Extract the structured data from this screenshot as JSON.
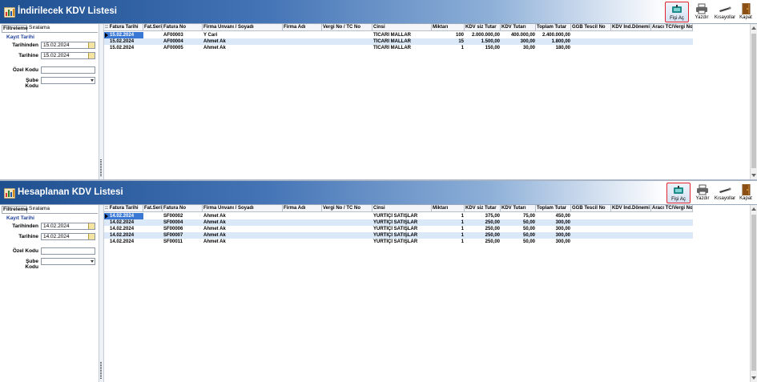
{
  "columns": [
    {
      "label": ":: Fatura Tarihi",
      "w": 49
    },
    {
      "label": "Fat.Seri",
      "w": 24
    },
    {
      "label": "Fatura No",
      "w": 50
    },
    {
      "label": "Firma Unvanı / Soyadı",
      "w": 100
    },
    {
      "label": "Firma Adı",
      "w": 49
    },
    {
      "label": "Vergi No / TC No",
      "w": 63
    },
    {
      "label": "Cinsi",
      "w": 74
    },
    {
      "label": "Miktarı",
      "w": 41
    },
    {
      "label": "KDV siz Tutar",
      "w": 45
    },
    {
      "label": "KDV Tutarı",
      "w": 44
    },
    {
      "label": "Toplam Tutar",
      "w": 44
    },
    {
      "label": "GGB Tescil No",
      "w": 50
    },
    {
      "label": "KDV İnd.Dönemi",
      "w": 50
    },
    {
      "label": "Aracı TC/Vergi No",
      "w": 52
    }
  ],
  "top": {
    "title": "İndirilecek KDV Listesi",
    "tabs": [
      "Filtreleme",
      "Sıralama"
    ],
    "filters": {
      "kayit_tarihi": "Kayıt Tarihi",
      "tarihinden_label": "Tarihinden",
      "tarihinden_value": "15.02.2024",
      "tarihine_label": "Tarihine",
      "tarihine_value": "15.02.2024",
      "ozel_kodu_label": "Özel Kodu",
      "ozel_kodu_value": "",
      "sube_kodu_label": "Şube Kodu",
      "sube_kodu_value": ""
    },
    "toolbar": {
      "fisi_ac": "Fişi Aç",
      "yazdir": "Yazdır",
      "kisayollar": "Kısayollar",
      "kapat": "Kapat"
    },
    "rows": [
      [
        "15.02.2024",
        "",
        "AF00003",
        "Y Cari",
        "",
        "",
        "TİCARİ MALLAR",
        "100",
        "2.000.000,00",
        "400.000,00",
        "2.400.000,00",
        "",
        "",
        ""
      ],
      [
        "15.02.2024",
        "",
        "AF00004",
        "Ahmet Ak",
        "",
        "",
        "TİCARİ MALLAR",
        "15",
        "1.500,00",
        "300,00",
        "1.800,00",
        "",
        "",
        ""
      ],
      [
        "15.02.2024",
        "",
        "AF00005",
        "Ahmet Ak",
        "",
        "",
        "TİCARİ MALLAR",
        "1",
        "150,00",
        "30,00",
        "180,00",
        "",
        "",
        ""
      ]
    ]
  },
  "bottom": {
    "title": "Hesaplanan KDV Listesi",
    "tabs": [
      "Filtreleme",
      "Sıralama"
    ],
    "filters": {
      "kayit_tarihi": "Kayıt Tarihi",
      "tarihinden_label": "Tarihinden",
      "tarihinden_value": "14.02.2024",
      "tarihine_label": "Tarihine",
      "tarihine_value": "14.02.2024",
      "ozel_kodu_label": "Özel Kodu",
      "ozel_kodu_value": "",
      "sube_kodu_label": "Şube Kodu",
      "sube_kodu_value": ""
    },
    "toolbar": {
      "fisi_ac": "Fişi Aç",
      "yazdir": "Yazdır",
      "kisayollar": "Kısayollar",
      "kapat": "Kapat"
    },
    "rows": [
      [
        "14.02.2024",
        "",
        "SF00002",
        "Ahmet Ak",
        "",
        "",
        "YURTİÇİ SATIŞLAR",
        "1",
        "375,00",
        "75,00",
        "450,00",
        "",
        "",
        ""
      ],
      [
        "14.02.2024",
        "",
        "SF00004",
        "Ahmet Ak",
        "",
        "",
        "YURTİÇİ SATIŞLAR",
        "1",
        "250,00",
        "50,00",
        "300,00",
        "",
        "",
        ""
      ],
      [
        "14.02.2024",
        "",
        "SF00006",
        "Ahmet Ak",
        "",
        "",
        "YURTİÇİ SATIŞLAR",
        "1",
        "250,00",
        "50,00",
        "300,00",
        "",
        "",
        ""
      ],
      [
        "14.02.2024",
        "",
        "SF00007",
        "Ahmet Ak",
        "",
        "",
        "YURTİÇİ SATIŞLAR",
        "1",
        "250,00",
        "50,00",
        "300,00",
        "",
        "",
        ""
      ],
      [
        "14.02.2024",
        "",
        "SF00011",
        "Ahmet Ak",
        "",
        "",
        "YURTİÇİ SATIŞLAR",
        "1",
        "250,00",
        "50,00",
        "300,00",
        "",
        "",
        ""
      ]
    ]
  },
  "colors": {
    "accent": "#1e4f8f",
    "row_alt": "#dbe8f7",
    "selection": "#3a78d6",
    "active_button_border": "#e0232e"
  },
  "icons": [
    "app-icon",
    "open-receipt-icon",
    "printer-icon",
    "shortcuts-icon",
    "exit-door-icon",
    "calendar-icon",
    "chevron-down-icon"
  ]
}
